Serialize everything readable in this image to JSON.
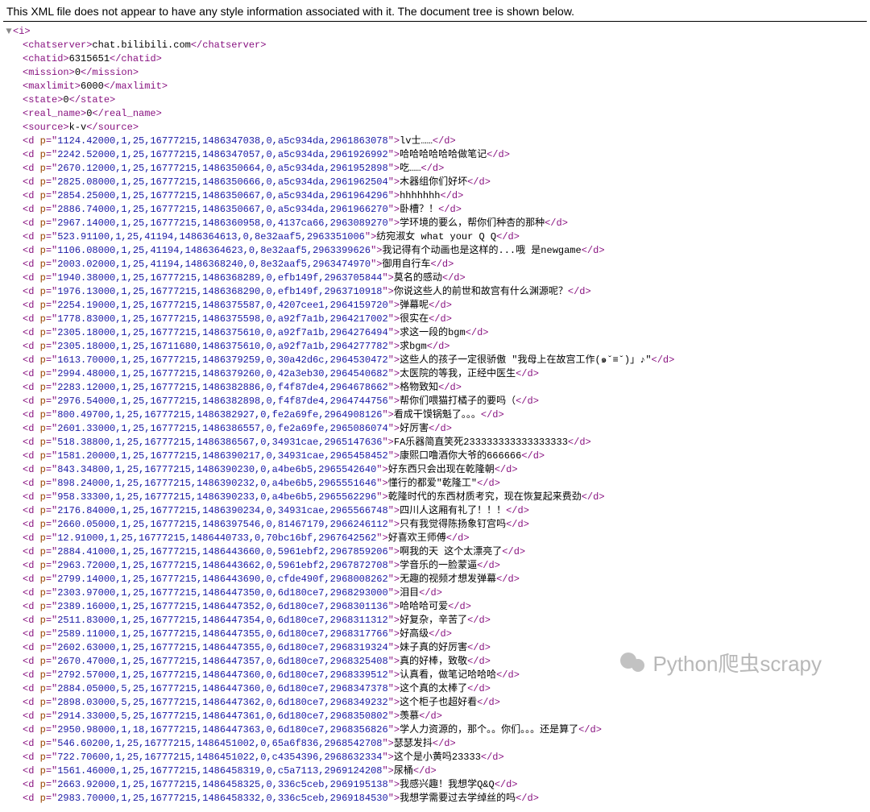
{
  "notice": "This XML file does not appear to have any style information associated with it. The document tree is shown below.",
  "root_tag": "i",
  "meta": [
    {
      "tag": "chatserver",
      "val": "chat.bilibili.com"
    },
    {
      "tag": "chatid",
      "val": "6315651"
    },
    {
      "tag": "mission",
      "val": "0"
    },
    {
      "tag": "maxlimit",
      "val": "6000"
    },
    {
      "tag": "state",
      "val": "0"
    },
    {
      "tag": "real_name",
      "val": "0"
    },
    {
      "tag": "source",
      "val": "k-v"
    }
  ],
  "d": [
    {
      "p": "1124.42000,1,25,16777215,1486347038,0,a5c934da,2961863078",
      "t": "lv士……"
    },
    {
      "p": "2242.52000,1,25,16777215,1486347057,0,a5c934da,2961926992",
      "t": "哈哈哈哈哈哈做笔记"
    },
    {
      "p": "2670.12000,1,25,16777215,1486350664,0,a5c934da,2961952898",
      "t": "吃……"
    },
    {
      "p": "2825.08000,1,25,16777215,1486350666,0,a5c934da,2961962504",
      "t": "木器组你们好坏"
    },
    {
      "p": "2854.25000,1,25,16777215,1486350667,0,a5c934da,2961964296",
      "t": "hhhhhhh"
    },
    {
      "p": "2886.74000,1,25,16777215,1486350667,0,a5c934da,2961966270",
      "t": "卧槽？！"
    },
    {
      "p": "2967.14000,1,25,16777215,1486360958,0,4137ca66,2963089270",
      "t": "学环境的要么，帮你们种杏的那种"
    },
    {
      "p": "523.91100,1,25,41194,1486364613,0,8e32aaf5,2963351006",
      "t": "纺宛淑女 what your Q Q"
    },
    {
      "p": "1106.08000,1,25,41194,1486364623,0,8e32aaf5,2963399626",
      "t": "我记得有个动画也是这样的...哦 是newgame"
    },
    {
      "p": "2003.02000,1,25,41194,1486368240,0,8e32aaf5,2963474970",
      "t": "御用自行车"
    },
    {
      "p": "1940.38000,1,25,16777215,1486368289,0,efb149f,2963705844",
      "t": "莫名的感动"
    },
    {
      "p": "1976.13000,1,25,16777215,1486368290,0,efb149f,2963710918",
      "t": "你说这些人的前世和故宫有什么渊源呢？"
    },
    {
      "p": "2254.19000,1,25,16777215,1486375587,0,4207cee1,2964159720",
      "t": "弹幕呢"
    },
    {
      "p": "1778.83000,1,25,16777215,1486375598,0,a92f7a1b,2964217002",
      "t": "很实在"
    },
    {
      "p": "2305.18000,1,25,16777215,1486375610,0,a92f7a1b,2964276494",
      "t": "求这一段的bgm"
    },
    {
      "p": "2305.18000,1,25,16711680,1486375610,0,a92f7a1b,2964277782",
      "t": "求bgm"
    },
    {
      "p": "1613.70000,1,25,16777215,1486379259,0,30a42d6c,2964530472",
      "t": "这些人的孩子一定很骄傲 \"我母上在故宫工作(๑ˇ≡ˇ)」♪\""
    },
    {
      "p": "2994.48000,1,25,16777215,1486379260,0,42a3eb30,2964540682",
      "t": "太医院的等我，正经中医生"
    },
    {
      "p": "2283.12000,1,25,16777215,1486382886,0,f4f87de4,2964678662",
      "t": "格物致知"
    },
    {
      "p": "2976.54000,1,25,16777215,1486382898,0,f4f87de4,2964744756",
      "t": "帮你们喂猫打橘子的要吗（"
    },
    {
      "p": "800.49700,1,25,16777215,1486382927,0,fe2a69fe,2964908126",
      "t": "看成干馍锅魁了。。。"
    },
    {
      "p": "2601.33000,1,25,16777215,1486386557,0,fe2a69fe,2965086074",
      "t": "好厉害"
    },
    {
      "p": "518.38800,1,25,16777215,1486386567,0,34931cae,2965147636",
      "t": "FA乐器简直笑死233333333333333333"
    },
    {
      "p": "1581.20000,1,25,16777215,1486390217,0,34931cae,2965458452",
      "t": "康熙口噜酒你大爷的666666"
    },
    {
      "p": "843.34800,1,25,16777215,1486390230,0,a4be6b5,2965542640",
      "t": "好东西只会出现在乾隆朝"
    },
    {
      "p": "898.24000,1,25,16777215,1486390232,0,a4be6b5,2965551646",
      "t": "懂行的都爱\"乾隆工\""
    },
    {
      "p": "958.33300,1,25,16777215,1486390233,0,a4be6b5,2965562296",
      "t": "乾隆时代的东西材质考究，现在恢复起来费劲"
    },
    {
      "p": "2176.84000,1,25,16777215,1486390234,0,34931cae,2965566748",
      "t": "四川人这厢有礼了！！！"
    },
    {
      "p": "2660.05000,1,25,16777215,1486397546,0,81467179,2966246112",
      "t": "只有我觉得陈扬象钉宫吗"
    },
    {
      "p": "12.91000,1,25,16777215,1486440733,0,70bc16bf,2967642562",
      "t": "好喜欢王师傅"
    },
    {
      "p": "2884.41000,1,25,16777215,1486443660,0,5961ebf2,2967859206",
      "t": "啊我的天 这个太漂亮了"
    },
    {
      "p": "2963.72000,1,25,16777215,1486443662,0,5961ebf2,2967872708",
      "t": "学音乐的一脸蒙逼"
    },
    {
      "p": "2799.14000,1,25,16777215,1486443690,0,cfde490f,2968008262",
      "t": "无趣的视频才想发弹幕"
    },
    {
      "p": "2303.97000,1,25,16777215,1486447350,0,6d180ce7,2968293000",
      "t": "泪目"
    },
    {
      "p": "2389.16000,1,25,16777215,1486447352,0,6d180ce7,2968301136",
      "t": "哈哈哈可爱"
    },
    {
      "p": "2511.83000,1,25,16777215,1486447354,0,6d180ce7,2968311312",
      "t": "好复杂，辛苦了"
    },
    {
      "p": "2589.11000,1,25,16777215,1486447355,0,6d180ce7,2968317766",
      "t": "好高级"
    },
    {
      "p": "2602.63000,1,25,16777215,1486447355,0,6d180ce7,2968319324",
      "t": "妹子真的好厉害"
    },
    {
      "p": "2670.47000,1,25,16777215,1486447357,0,6d180ce7,2968325408",
      "t": "真的好棒，致敬"
    },
    {
      "p": "2792.57000,1,25,16777215,1486447360,0,6d180ce7,2968339512",
      "t": "认真看，做笔记哈哈哈"
    },
    {
      "p": "2884.05000,5,25,16777215,1486447360,0,6d180ce7,2968347378",
      "t": "这个真的太棒了"
    },
    {
      "p": "2898.03000,5,25,16777215,1486447362,0,6d180ce7,2968349232",
      "t": "这个柜子也超好看"
    },
    {
      "p": "2914.33000,5,25,16777215,1486447361,0,6d180ce7,2968350802",
      "t": "羡慕"
    },
    {
      "p": "2950.98000,1,18,16777215,1486447363,0,6d180ce7,2968356826",
      "t": "学人力资源的，那个。。你们。。。还是算了"
    },
    {
      "p": "546.60200,1,25,16777215,1486451002,0,65a6f836,2968542708",
      "t": "瑟瑟发抖"
    },
    {
      "p": "722.70600,1,25,16777215,1486451022,0,c4354396,2968632334",
      "t": "这个是小黄吗23333"
    },
    {
      "p": "1561.46000,1,25,16777215,1486458319,0,c5a7113,2969124208",
      "t": "尿桶"
    },
    {
      "p": "2663.92000,1,25,16777215,1486458325,0,336c5ceb,2969195138",
      "t": "我感兴趣！我想学Q&Q"
    },
    {
      "p": "2983.70000,1,25,16777215,1486458332,0,336c5ceb,2969184530",
      "t": "我想学需要过去学绰丝的吗"
    }
  ],
  "watermark": "Python爬虫scrapy"
}
